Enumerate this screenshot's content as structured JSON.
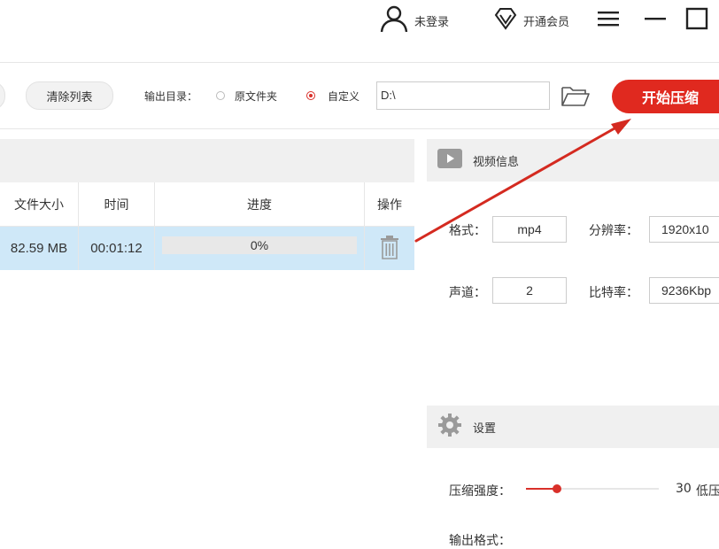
{
  "header": {
    "login_label": "未登录",
    "vip_label": "开通会员"
  },
  "toolbar": {
    "clear_list_label": "清除列表",
    "output_dir_label": "输出目录：",
    "option_source_folder": "原文件夹",
    "option_custom": "自定义",
    "selected_option": "自定义",
    "output_path": "D:\\",
    "start_button_label": "开始压缩"
  },
  "file_table": {
    "columns": [
      "文件大小",
      "时间",
      "进度",
      "操作"
    ],
    "rows": [
      {
        "size": "82.59 MB",
        "time": "00:01:12",
        "progress_text": "0%",
        "progress": 0
      }
    ]
  },
  "video_info": {
    "title": "视频信息",
    "format_label": "格式：",
    "format_value": "mp4",
    "resolution_label": "分辨率：",
    "resolution_value": "1920x10",
    "channel_label": "声道：",
    "channel_value": "2",
    "bitrate_label": "比特率：",
    "bitrate_value": "9236Kbp"
  },
  "settings": {
    "title": "设置",
    "strength_label": "压缩强度：",
    "strength_value": "30",
    "strength_tag": "低压",
    "output_format_label": "输出格式："
  },
  "colors": {
    "accent": "#e0291f",
    "row_selected": "#cfe8f8",
    "section_bg": "#f0f0f0"
  },
  "icons": [
    "user-icon",
    "diamond-icon",
    "menu-icon",
    "minimize-icon",
    "maximize-icon",
    "folder-icon",
    "play-icon",
    "trash-icon",
    "gear-icon"
  ]
}
